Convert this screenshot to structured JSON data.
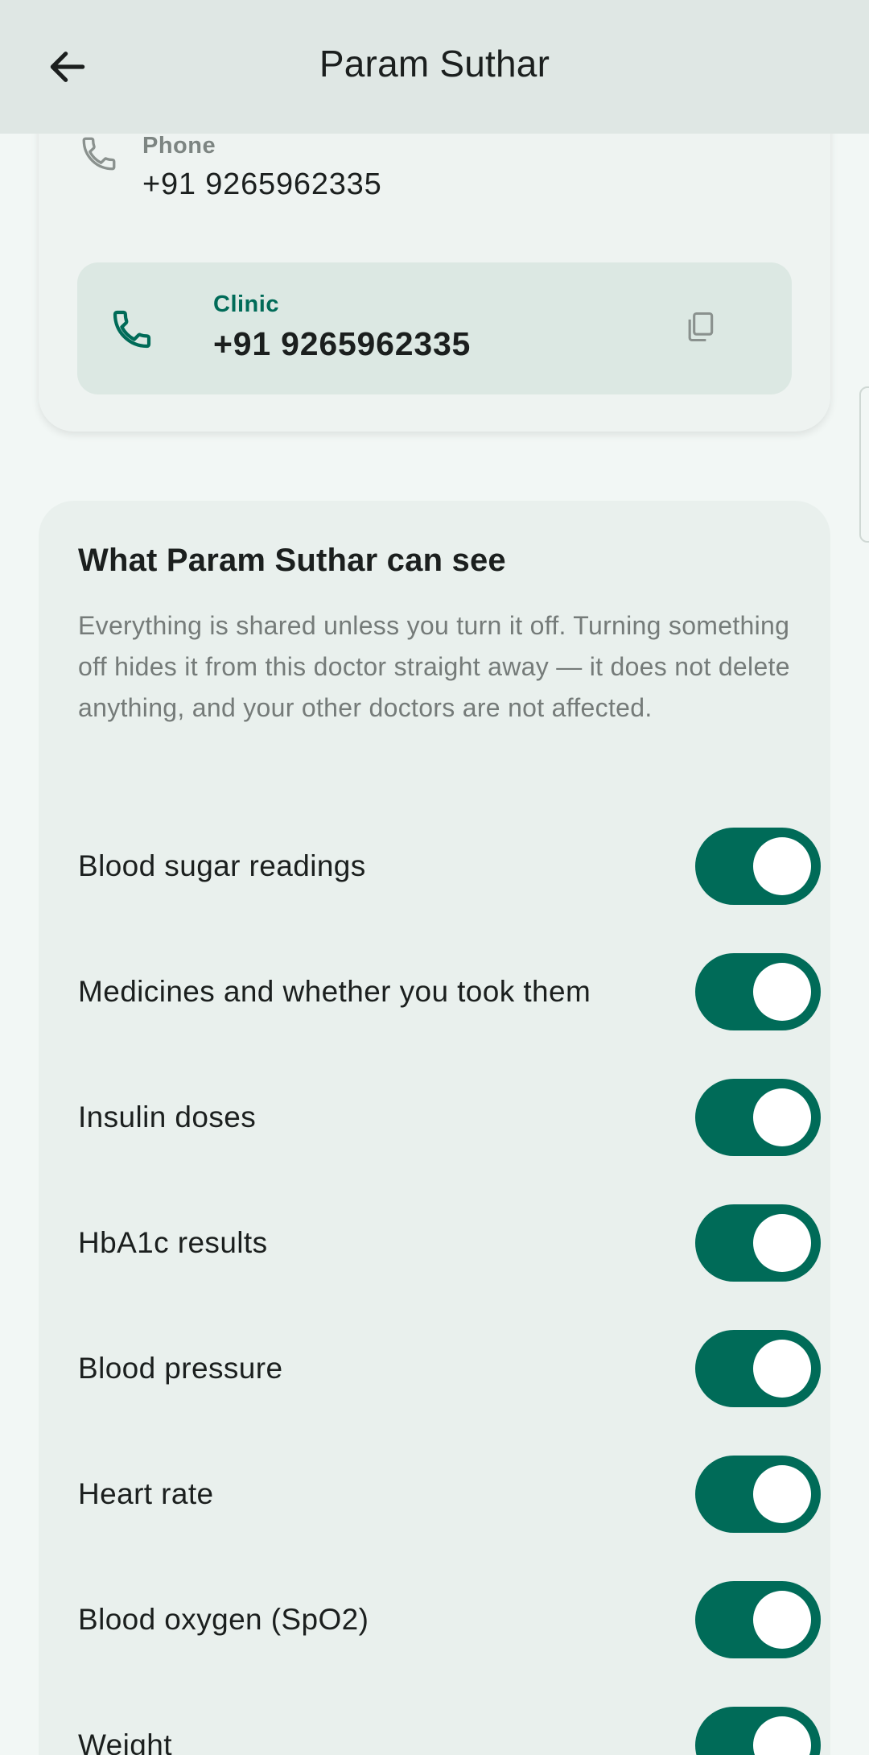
{
  "app_bar": {
    "title": "Param Suthar",
    "back_icon": "arrow-left-icon"
  },
  "contact": {
    "phone_label": "Phone",
    "phone_value": "+91 9265962335",
    "phone_icon": "phone-icon",
    "clinic_label": "Clinic",
    "clinic_value": "+91 9265962335",
    "clinic_icon": "phone-icon",
    "copy_icon": "copy-icon"
  },
  "sharing": {
    "title": "What Param Suthar can see",
    "description": "Everything is shared unless you turn it off. Turning something off hides it from this doctor straight away — it does not delete anything, and your other doctors are not affected.",
    "items": [
      {
        "label": "Blood sugar readings",
        "enabled": true
      },
      {
        "label": "Medicines and whether you took them",
        "enabled": true
      },
      {
        "label": "Insulin doses",
        "enabled": true
      },
      {
        "label": "HbA1c results",
        "enabled": true
      },
      {
        "label": "Blood pressure",
        "enabled": true
      },
      {
        "label": "Heart rate",
        "enabled": true
      },
      {
        "label": "Blood oxygen (SpO2)",
        "enabled": true
      },
      {
        "label": "Weight",
        "enabled": true
      }
    ]
  },
  "colors": {
    "accent": "#006b58",
    "app_bar_bg": "#dfe7e4",
    "page_bg": "#f2f7f5",
    "clinic_box_bg": "#dce8e3"
  }
}
